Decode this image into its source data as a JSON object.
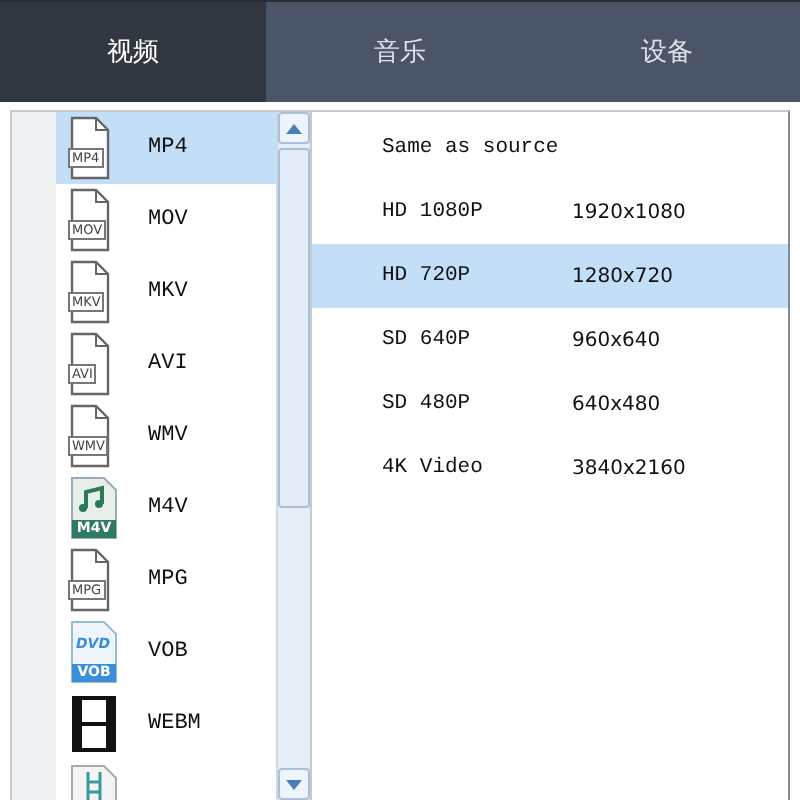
{
  "tabs": [
    {
      "label": "视频",
      "selected": true
    },
    {
      "label": "音乐",
      "selected": false
    },
    {
      "label": "设备",
      "selected": false
    }
  ],
  "formats": [
    {
      "label": "MP4",
      "kind": "doc",
      "badge": "MP4",
      "selected": true
    },
    {
      "label": "MOV",
      "kind": "doc",
      "badge": "MOV",
      "selected": false
    },
    {
      "label": "MKV",
      "kind": "doc",
      "badge": "MKV",
      "selected": false
    },
    {
      "label": "AVI",
      "kind": "doc",
      "badge": "AVI",
      "selected": false
    },
    {
      "label": "WMV",
      "kind": "doc",
      "badge": "WMV",
      "selected": false
    },
    {
      "label": "M4V",
      "kind": "music",
      "badge": "M4V",
      "selected": false
    },
    {
      "label": "MPG",
      "kind": "doc",
      "badge": "MPG",
      "selected": false
    },
    {
      "label": "VOB",
      "kind": "dvd",
      "badge": "VOB",
      "logo": "DVD",
      "selected": false
    },
    {
      "label": "WEBM",
      "kind": "film",
      "selected": false
    },
    {
      "kind": "ladder",
      "selected": false
    }
  ],
  "resolutions": [
    {
      "name": "Same as source",
      "selected": false
    },
    {
      "name": "HD 1080P",
      "size": "1920x1080",
      "selected": false
    },
    {
      "name": "HD 720P",
      "size": "1280x720",
      "selected": true
    },
    {
      "name": "SD 640P",
      "size": "960x640",
      "selected": false
    },
    {
      "name": "SD 480P",
      "size": "640x480",
      "selected": false
    },
    {
      "name": "4K Video",
      "size": "3840x2160",
      "selected": false
    }
  ]
}
